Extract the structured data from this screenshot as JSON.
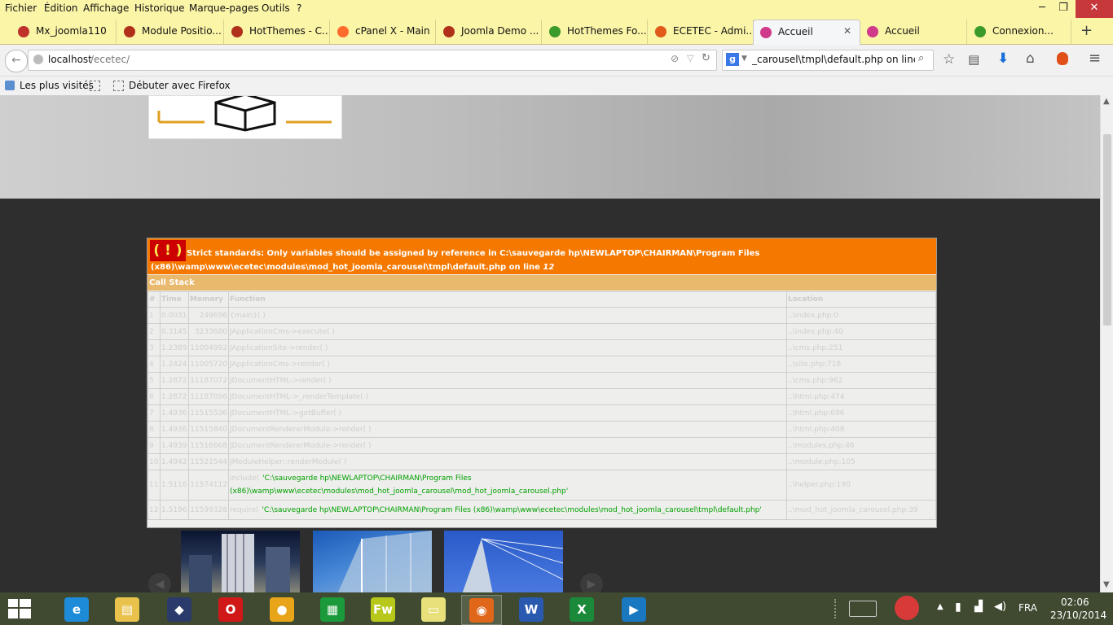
{
  "menubar": {
    "items": [
      "Fichier",
      "Édition",
      "Affichage",
      "Historique",
      "Marque-pages",
      "Outils",
      "?"
    ],
    "minimize": "─",
    "restore": "❐",
    "close": "✕"
  },
  "tabs": [
    {
      "label": "Mx_joomla110",
      "favicon_color": "#c0312b"
    },
    {
      "label": "Module Positio...",
      "favicon_color": "#b0301a"
    },
    {
      "label": "HotThemes - C...",
      "favicon_color": "#b0301a"
    },
    {
      "label": "cPanel X - Main",
      "favicon_color": "#ff6c2c"
    },
    {
      "label": "Joomla Demo ...",
      "favicon_color": "#b0301a"
    },
    {
      "label": "HotThemes Fo...",
      "favicon_color": "#3a9a2a"
    },
    {
      "label": "ECETEC - Admi...",
      "favicon_color": "#e05a1a"
    },
    {
      "label": "Accueil",
      "favicon_color": "#d03a8a",
      "active": true
    },
    {
      "label": "Accueil",
      "favicon_color": "#d03a8a"
    },
    {
      "label": "Connexion...",
      "favicon_color": "#3a9a2a"
    }
  ],
  "tab_close": "✕",
  "new_tab": "+",
  "navbar": {
    "url_host": "localhost",
    "url_path": "/ecetec/",
    "search_value": "_carousel\\tmpl\\default.php on line 12",
    "search_engine": "g"
  },
  "bookmarks": {
    "items": [
      "Les plus visités",
      "Débuter avec Firefox"
    ]
  },
  "error": {
    "bang": "( ! )",
    "message_prefix": "Strict standards: Only variables should be assigned by reference in C:\\sauvegarde hp\\NEWLAPTOP\\CHAIRMAN\\Program Files (x86)\\wamp\\www\\ecetec\\modules\\mod_hot_joomla_carousel\\tmpl\\default.php on line ",
    "line": "12",
    "callstack_title": "Call Stack",
    "columns": [
      "#",
      "Time",
      "Memory",
      "Function",
      "Location"
    ],
    "rows": [
      {
        "n": "1",
        "time": "0.0031",
        "mem": "249696",
        "fn": "{main}( )",
        "loc": "..\\index.php:0",
        "path": ""
      },
      {
        "n": "2",
        "time": "0.3145",
        "mem": "3233680",
        "fn": "JApplicationCms->execute( )",
        "loc": "..\\index.php:40",
        "path": ""
      },
      {
        "n": "3",
        "time": "1.2389",
        "mem": "11004992",
        "fn": "JApplicationSite->render( )",
        "loc": "..\\cms.php:251",
        "path": ""
      },
      {
        "n": "4",
        "time": "1.2424",
        "mem": "11005720",
        "fn": "JApplicationCms->render( )",
        "loc": "..\\site.php:718",
        "path": ""
      },
      {
        "n": "5",
        "time": "1.2872",
        "mem": "11187072",
        "fn": "JDocumentHTML->render( )",
        "loc": "..\\cms.php:962",
        "path": ""
      },
      {
        "n": "6",
        "time": "1.2872",
        "mem": "11187096",
        "fn": "JDocumentHTML->_renderTemplate( )",
        "loc": "..\\html.php:474",
        "path": ""
      },
      {
        "n": "7",
        "time": "1.4936",
        "mem": "11515536",
        "fn": "JDocumentHTML->getBuffer( )",
        "loc": "..\\html.php:696",
        "path": ""
      },
      {
        "n": "8",
        "time": "1.4936",
        "mem": "11515840",
        "fn": "JDocumentRendererModule->render( )",
        "loc": "..\\html.php:408",
        "path": ""
      },
      {
        "n": "9",
        "time": "1.4939",
        "mem": "11516668",
        "fn": "JDocumentRendererModule->render( )",
        "loc": "..\\modules.php:46",
        "path": ""
      },
      {
        "n": "10",
        "time": "1.4942",
        "mem": "11521544",
        "fn": "JModuleHelper::renderModule( )",
        "loc": "..\\module.php:105",
        "path": ""
      },
      {
        "n": "11",
        "time": "1.5116",
        "mem": "11574112",
        "fn": "include(",
        "loc": "..\\helper.php:190",
        "path": "'C:\\sauvegarde hp\\NEWLAPTOP\\CHAIRMAN\\Program Files (x86)\\wamp\\www\\ecetec\\modules\\mod_hot_joomla_carousel\\mod_hot_joomla_carousel.php'"
      },
      {
        "n": "12",
        "time": "1.5196",
        "mem": "11599328",
        "fn": "require(",
        "loc": "..\\mod_hot_joomla_carousel.php:39",
        "path": "'C:\\sauvegarde hp\\NEWLAPTOP\\CHAIRMAN\\Program Files (x86)\\wamp\\www\\ecetec\\modules\\mod_hot_joomla_carousel\\tmpl\\default.php'"
      }
    ]
  },
  "carousel": {
    "prev": "◀",
    "next": "▶"
  },
  "taskbar": {
    "apps": [
      {
        "name": "internet-explorer",
        "glyph": "e",
        "color": "#1e8bd8"
      },
      {
        "name": "file-explorer",
        "glyph": "▤",
        "color": "#e8c24a"
      },
      {
        "name": "app-launcher",
        "glyph": "◆",
        "color": "#2a3a6a"
      },
      {
        "name": "opera",
        "glyph": "O",
        "color": "#d01818"
      },
      {
        "name": "chrome",
        "glyph": "●",
        "color": "#e8a51a"
      },
      {
        "name": "store",
        "glyph": "▦",
        "color": "#1a9a3a"
      },
      {
        "name": "fireworks",
        "glyph": "Fw",
        "color": "#b8c81a"
      },
      {
        "name": "sticky-notes",
        "glyph": "▭",
        "color": "#e8e07a"
      },
      {
        "name": "firefox",
        "glyph": "◉",
        "color": "#e0661a",
        "active": true
      },
      {
        "name": "word",
        "glyph": "W",
        "color": "#2a5ab0"
      },
      {
        "name": "excel",
        "glyph": "X",
        "color": "#1a8a3a"
      },
      {
        "name": "media-player",
        "glyph": "▶",
        "color": "#1a78c0"
      }
    ],
    "language": "FRA",
    "time": "02:06",
    "date": "23/10/2014"
  }
}
